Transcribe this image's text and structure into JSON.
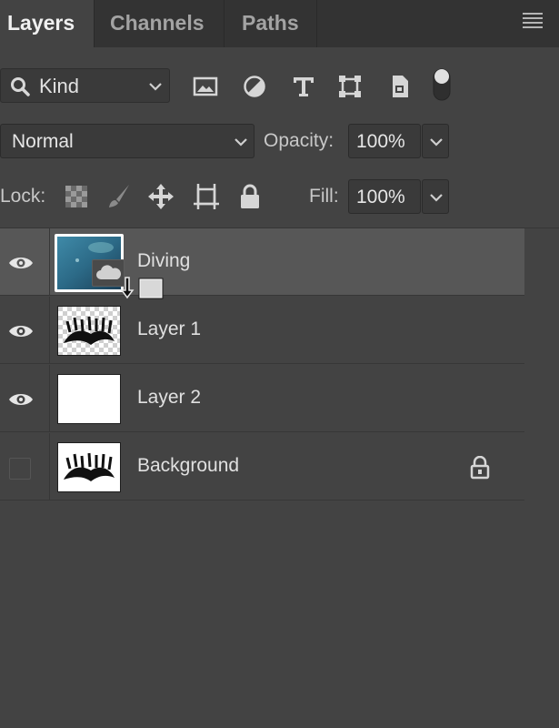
{
  "tabs": [
    {
      "label": "Layers",
      "active": true
    },
    {
      "label": "Channels",
      "active": false
    },
    {
      "label": "Paths",
      "active": false
    }
  ],
  "filter": {
    "kind_label": "Kind",
    "filter_icons": [
      "image-filter-icon",
      "adjustment-filter-icon",
      "type-filter-icon",
      "shape-filter-icon",
      "smart-object-filter-icon",
      "filter-toggle-icon"
    ]
  },
  "blend": {
    "mode": "Normal",
    "opacity_label": "Opacity:",
    "opacity_value": "100%"
  },
  "lock": {
    "label": "Lock:",
    "icons": [
      "lock-transparent-pixels-icon",
      "lock-image-pixels-icon",
      "lock-position-icon",
      "lock-artboard-icon",
      "lock-all-icon"
    ],
    "fill_label": "Fill:",
    "fill_value": "100%"
  },
  "layers": [
    {
      "name": "Diving",
      "visible": true,
      "selected": true,
      "thumb": "underwater-photo",
      "locked": false
    },
    {
      "name": "Layer 1",
      "visible": true,
      "selected": false,
      "thumb": "transparent-art",
      "locked": false
    },
    {
      "name": "Layer 2",
      "visible": true,
      "selected": false,
      "thumb": "white-fill",
      "locked": false
    },
    {
      "name": "Background",
      "visible": false,
      "selected": false,
      "thumb": "art-on-white",
      "locked": true
    }
  ],
  "colors": {
    "panel_bg": "#434343",
    "tabbar_bg": "#333333",
    "selected_row": "#575757",
    "text": "#e0e0e0"
  }
}
